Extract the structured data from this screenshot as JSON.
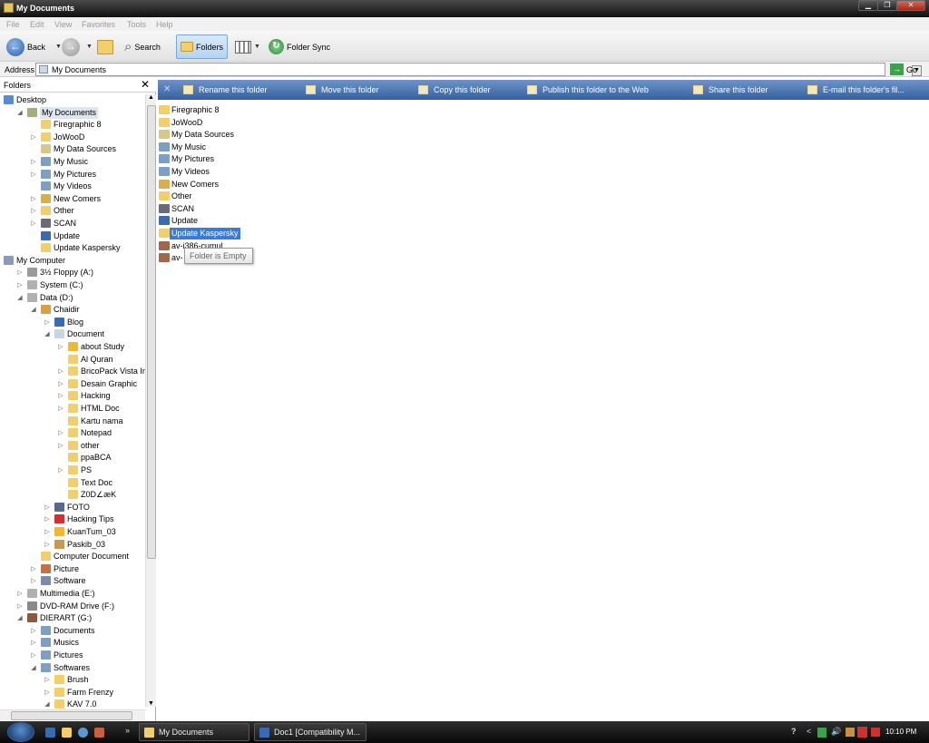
{
  "window": {
    "title": "My Documents"
  },
  "menu": [
    "File",
    "Edit",
    "View",
    "Favorites",
    "Tools",
    "Help"
  ],
  "toolbar": {
    "back": "Back",
    "search": "Search",
    "folders": "Folders",
    "folder_sync": "Folder Sync"
  },
  "address": {
    "label": "Address",
    "value": "My Documents",
    "go": "Go"
  },
  "folders_pane": {
    "title": "Folders",
    "close": "✕"
  },
  "tree": [
    {
      "label": "Desktop",
      "d": 0,
      "exp": "",
      "icon": "desktop-icon",
      "c": "#5a8ad0"
    },
    {
      "label": "My Documents",
      "d": 1,
      "exp": "◢",
      "icon": "my-documents-icon",
      "c": "#9fb07a",
      "sel": true
    },
    {
      "label": "Firegraphic 8",
      "d": 2,
      "exp": "",
      "icon": "folder-icon",
      "c": "#f2cf6a"
    },
    {
      "label": "JoWooD",
      "d": 2,
      "exp": "▷",
      "icon": "folder-icon",
      "c": "#f2cf6a"
    },
    {
      "label": "My Data Sources",
      "d": 2,
      "exp": "",
      "icon": "data-sources-icon",
      "c": "#d9c78a"
    },
    {
      "label": "My Music",
      "d": 2,
      "exp": "▷",
      "icon": "music-folder-icon",
      "c": "#7aa0c8"
    },
    {
      "label": "My Pictures",
      "d": 2,
      "exp": "▷",
      "icon": "pictures-folder-icon",
      "c": "#7aa0c8"
    },
    {
      "label": "My Videos",
      "d": 2,
      "exp": "",
      "icon": "videos-folder-icon",
      "c": "#7aa0c8"
    },
    {
      "label": "New Comers",
      "d": 2,
      "exp": "▷",
      "icon": "folder-icon",
      "c": "#d8b04a"
    },
    {
      "label": "Other",
      "d": 2,
      "exp": "▷",
      "icon": "folder-icon",
      "c": "#f2cf6a"
    },
    {
      "label": "SCAN",
      "d": 2,
      "exp": "▷",
      "icon": "scanner-icon",
      "c": "#6a6a7a"
    },
    {
      "label": "Update",
      "d": 2,
      "exp": "",
      "icon": "globe-icon",
      "c": "#3a6ab0"
    },
    {
      "label": "Update Kaspersky",
      "d": 2,
      "exp": "",
      "icon": "folder-icon",
      "c": "#f2cf6a"
    },
    {
      "label": "My Computer",
      "d": 0,
      "exp": "◢",
      "icon": "computer-icon",
      "c": "#8a9ab8"
    },
    {
      "label": "3½ Floppy (A:)",
      "d": 1,
      "exp": "▷",
      "icon": "floppy-icon",
      "c": "#9a9a9a"
    },
    {
      "label": "System (C:)",
      "d": 1,
      "exp": "▷",
      "icon": "drive-icon",
      "c": "#b0b0b0"
    },
    {
      "label": "Data (D:)",
      "d": 1,
      "exp": "◢",
      "icon": "drive-icon",
      "c": "#b0b0b0"
    },
    {
      "label": "Chaidir",
      "d": 2,
      "exp": "◢",
      "icon": "user-folder-icon",
      "c": "#d8a040"
    },
    {
      "label": "Blog",
      "d": 3,
      "exp": "▷",
      "icon": "globe-icon",
      "c": "#3a6ab0"
    },
    {
      "label": "Document",
      "d": 3,
      "exp": "◢",
      "icon": "document-folder-icon",
      "c": "#c8d4e4"
    },
    {
      "label": "about Study",
      "d": 4,
      "exp": "▷",
      "icon": "star-folder-icon",
      "c": "#f0b830"
    },
    {
      "label": "Al Quran",
      "d": 4,
      "exp": "",
      "icon": "folder-icon",
      "c": "#f2cf6a"
    },
    {
      "label": "BricoPack Vista Inspirat",
      "d": 4,
      "exp": "▷",
      "icon": "folder-icon",
      "c": "#f2cf6a"
    },
    {
      "label": "Desain Graphic",
      "d": 4,
      "exp": "▷",
      "icon": "folder-icon",
      "c": "#f2cf6a"
    },
    {
      "label": "Hacking",
      "d": 4,
      "exp": "▷",
      "icon": "folder-icon",
      "c": "#f2cf6a"
    },
    {
      "label": "HTML Doc",
      "d": 4,
      "exp": "▷",
      "icon": "folder-icon",
      "c": "#f2cf6a"
    },
    {
      "label": "Kartu nama",
      "d": 4,
      "exp": "",
      "icon": "folder-icon",
      "c": "#f2cf6a"
    },
    {
      "label": "Notepad",
      "d": 4,
      "exp": "▷",
      "icon": "folder-icon",
      "c": "#f2cf6a"
    },
    {
      "label": "other",
      "d": 4,
      "exp": "▷",
      "icon": "folder-icon",
      "c": "#f2cf6a"
    },
    {
      "label": "ppaBCA",
      "d": 4,
      "exp": "",
      "icon": "folder-icon",
      "c": "#f2cf6a"
    },
    {
      "label": "PS",
      "d": 4,
      "exp": "▷",
      "icon": "folder-icon",
      "c": "#f2cf6a"
    },
    {
      "label": "Text Doc",
      "d": 4,
      "exp": "",
      "icon": "folder-icon",
      "c": "#f2cf6a"
    },
    {
      "label": "Z0D∠æK",
      "d": 4,
      "exp": "",
      "icon": "folder-icon",
      "c": "#f2cf6a"
    },
    {
      "label": "FOTO",
      "d": 3,
      "exp": "▷",
      "icon": "photo-folder-icon",
      "c": "#5a6a8a"
    },
    {
      "label": "Hacking Tips",
      "d": 3,
      "exp": "▷",
      "icon": "error-folder-icon",
      "c": "#d03030"
    },
    {
      "label": "KuanTum_03",
      "d": 3,
      "exp": "▷",
      "icon": "star-folder-icon",
      "c": "#f0b830"
    },
    {
      "label": "Paskib_03",
      "d": 3,
      "exp": "▷",
      "icon": "folder-icon",
      "c": "#c89850"
    },
    {
      "label": "Computer Document",
      "d": 2,
      "exp": "",
      "icon": "folder-icon",
      "c": "#f2cf6a"
    },
    {
      "label": "Picture",
      "d": 2,
      "exp": "▷",
      "icon": "picture-folder-icon",
      "c": "#c87040"
    },
    {
      "label": "Software",
      "d": 2,
      "exp": "▷",
      "icon": "software-folder-icon",
      "c": "#7a8ab0"
    },
    {
      "label": "Multimedia (E:)",
      "d": 1,
      "exp": "▷",
      "icon": "drive-icon",
      "c": "#b0b0b0"
    },
    {
      "label": "DVD-RAM Drive (F:)",
      "d": 1,
      "exp": "▷",
      "icon": "dvd-drive-icon",
      "c": "#8a8a8a"
    },
    {
      "label": "DIERART (G:)",
      "d": 1,
      "exp": "◢",
      "icon": "drive-photo-icon",
      "c": "#8a5a40"
    },
    {
      "label": "Documents",
      "d": 2,
      "exp": "▷",
      "icon": "document-folder-icon",
      "c": "#7aa0c8"
    },
    {
      "label": "Musics",
      "d": 2,
      "exp": "▷",
      "icon": "music-folder-icon",
      "c": "#7aa0c8"
    },
    {
      "label": "Pictures",
      "d": 2,
      "exp": "▷",
      "icon": "pictures-folder-icon",
      "c": "#7aa0c8"
    },
    {
      "label": "Softwares",
      "d": 2,
      "exp": "◢",
      "icon": "software-folder-icon",
      "c": "#7aa0c8"
    },
    {
      "label": "Brush",
      "d": 3,
      "exp": "▷",
      "icon": "folder-icon",
      "c": "#f2cf6a"
    },
    {
      "label": "Farm Frenzy",
      "d": 3,
      "exp": "▷",
      "icon": "folder-icon",
      "c": "#f2cf6a"
    },
    {
      "label": "KAV 7.0",
      "d": 3,
      "exp": "◢",
      "icon": "folder-icon",
      "c": "#f2cf6a"
    }
  ],
  "tasks": [
    {
      "label": "Rename this folder",
      "icon": "rename-icon"
    },
    {
      "label": "Move this folder",
      "icon": "move-icon"
    },
    {
      "label": "Copy this folder",
      "icon": "copy-icon"
    },
    {
      "label": "Publish this folder to the Web",
      "icon": "publish-icon"
    },
    {
      "label": "Share this folder",
      "icon": "share-icon"
    },
    {
      "label": "E-mail this folder's fil...",
      "icon": "email-icon"
    }
  ],
  "content": [
    {
      "label": "Firegraphic 8",
      "icon": "folder-icon",
      "c": "#f2cf6a"
    },
    {
      "label": "JoWooD",
      "icon": "folder-icon",
      "c": "#f2cf6a"
    },
    {
      "label": "My Data Sources",
      "icon": "data-sources-icon",
      "c": "#d9c78a"
    },
    {
      "label": "My Music",
      "icon": "music-folder-icon",
      "c": "#7aa0c8"
    },
    {
      "label": "My Pictures",
      "icon": "pictures-folder-icon",
      "c": "#7aa0c8"
    },
    {
      "label": "My Videos",
      "icon": "videos-folder-icon",
      "c": "#7aa0c8"
    },
    {
      "label": "New Comers",
      "icon": "folder-icon",
      "c": "#d8b04a"
    },
    {
      "label": "Other",
      "icon": "folder-icon",
      "c": "#f2cf6a"
    },
    {
      "label": "SCAN",
      "icon": "scanner-icon",
      "c": "#6a6a7a"
    },
    {
      "label": "Update",
      "icon": "globe-icon",
      "c": "#3a6ab0"
    },
    {
      "label": "Update Kaspersky",
      "icon": "folder-icon",
      "c": "#f2cf6a",
      "sel": true
    },
    {
      "label": "av-i386-cumul",
      "icon": "archive-icon",
      "c": "#a06848"
    },
    {
      "label": "av-",
      "icon": "archive-icon",
      "c": "#a06848"
    }
  ],
  "tooltip": "Folder is Empty",
  "taskbar": {
    "tasks": [
      {
        "label": "My Documents",
        "icon": "folder-icon",
        "c": "#f2cf6a"
      },
      {
        "label": "Doc1 [Compatibility M...",
        "icon": "word-icon",
        "c": "#3a6ab0"
      }
    ],
    "more": "»",
    "tray_chevron": "<",
    "help": "?",
    "clock": "10:10 PM"
  }
}
